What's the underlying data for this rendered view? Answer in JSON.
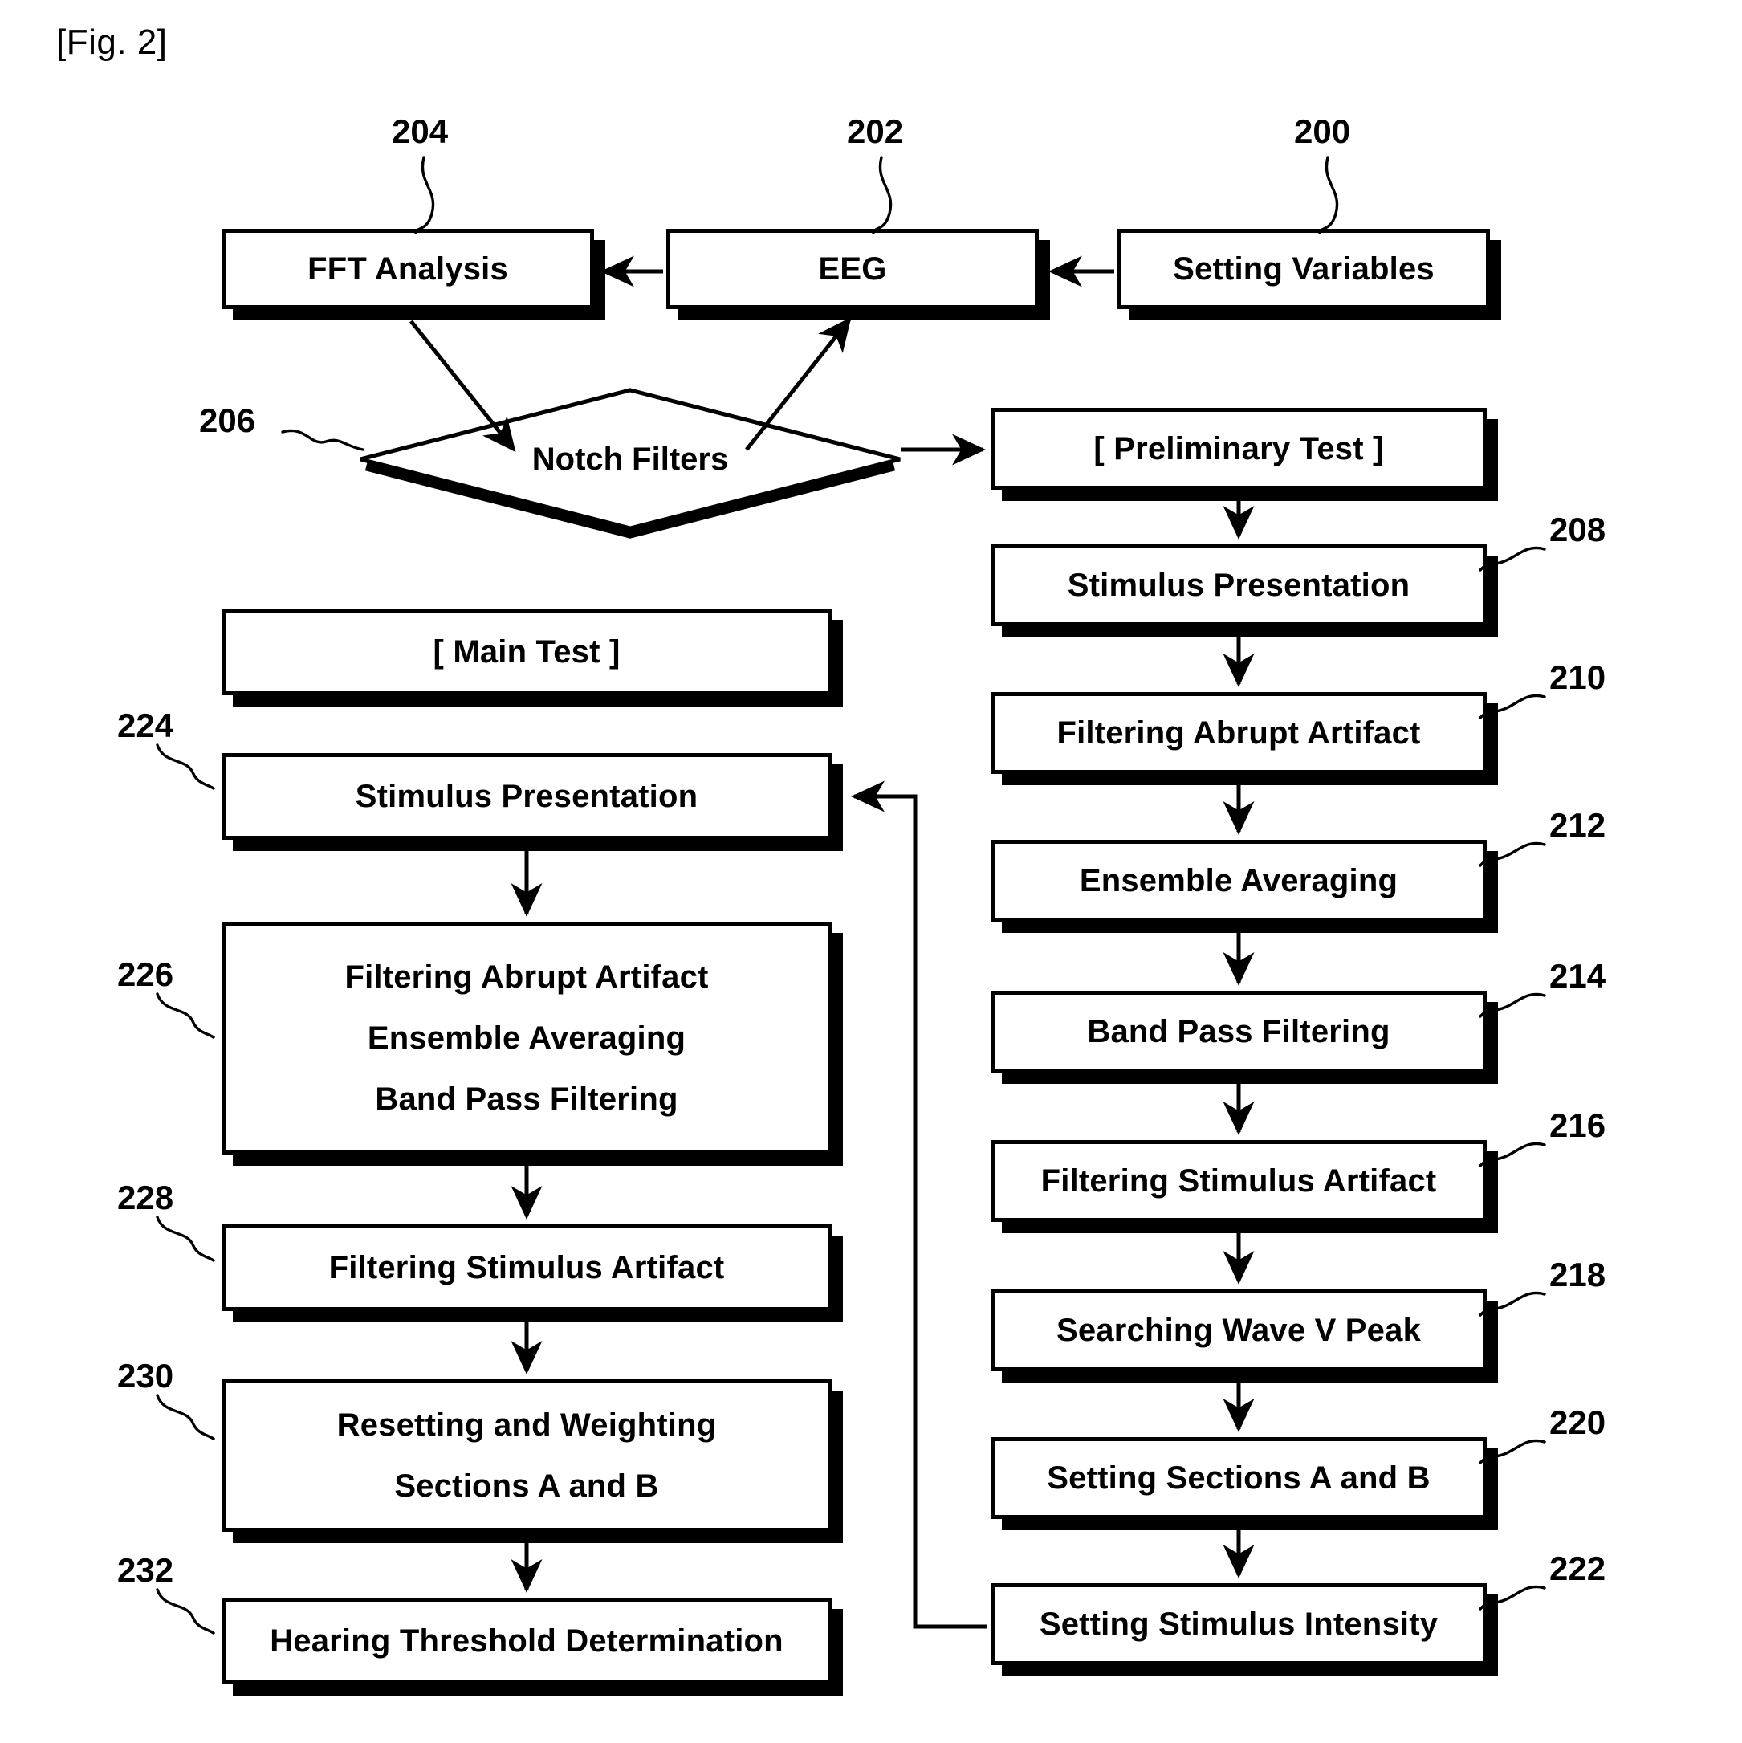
{
  "figure": {
    "label": "[Fig. 2]"
  },
  "boxes": {
    "fft_analysis": {
      "text": "FFT Analysis",
      "ref": "204"
    },
    "eeg": {
      "text": "EEG",
      "ref": "202"
    },
    "setting_variables": {
      "text": "Setting Variables",
      "ref": "200"
    },
    "notch_filters": {
      "text": "Notch Filters",
      "ref": "206"
    },
    "preliminary_test": {
      "text": "[ Preliminary Test ]",
      "ref": ""
    },
    "pre_stimulus": {
      "text": "Stimulus Presentation",
      "ref": "208"
    },
    "pre_abrupt": {
      "text": "Filtering Abrupt Artifact",
      "ref": "210"
    },
    "pre_ensemble": {
      "text": "Ensemble Averaging",
      "ref": "212"
    },
    "pre_bandpass": {
      "text": "Band Pass Filtering",
      "ref": "214"
    },
    "pre_stim_artifact": {
      "text": "Filtering Stimulus Artifact",
      "ref": "216"
    },
    "pre_wave_v": {
      "text": "Searching Wave V Peak",
      "ref": "218"
    },
    "pre_sections": {
      "text": "Setting Sections A and B",
      "ref": "220"
    },
    "pre_intensity": {
      "text": "Setting Stimulus Intensity",
      "ref": "222"
    },
    "main_test": {
      "text": "[ Main Test ]",
      "ref": ""
    },
    "main_stimulus": {
      "text": "Stimulus Presentation",
      "ref": "224"
    },
    "main_filters": {
      "text": "Filtering Abrupt Artifact\nEnsemble Averaging\nBand Pass Filtering",
      "ref": "226"
    },
    "main_stim_artifact": {
      "text": "Filtering Stimulus Artifact",
      "ref": "228"
    },
    "main_resetting": {
      "text": "Resetting and Weighting\nSections A and B",
      "ref": "230"
    },
    "main_threshold": {
      "text": "Hearing Threshold Determination",
      "ref": "232"
    }
  },
  "colors": {
    "ink": "#000000",
    "paper": "#ffffff"
  }
}
